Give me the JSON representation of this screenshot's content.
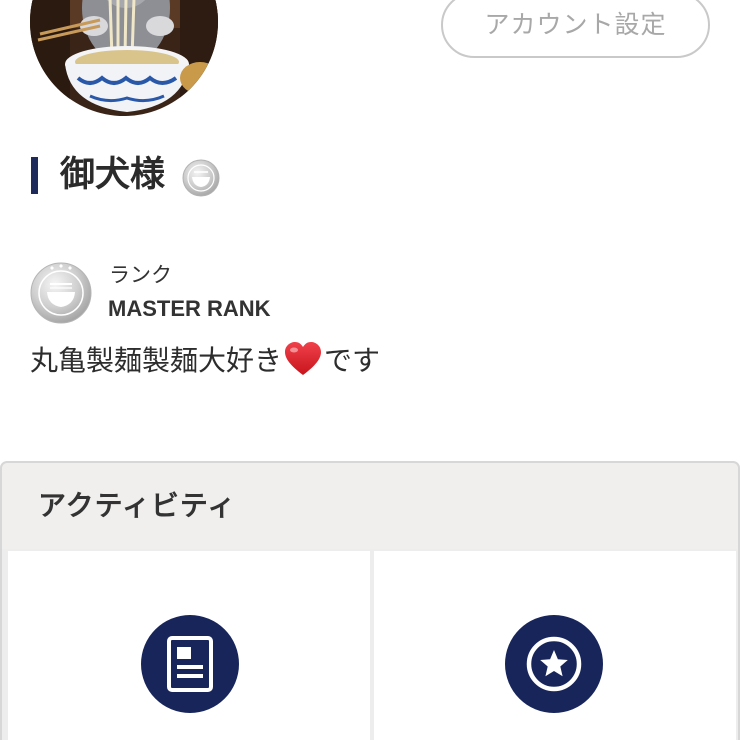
{
  "profile": {
    "avatar_alt": "avatar",
    "name": "御犬様",
    "name_badge_icon": "ramen-bowl-badge-icon",
    "account_settings_label": "アカウント設定"
  },
  "rank": {
    "label": "ランク",
    "value": "MASTER RANK",
    "badge_icon": "master-rank-badge-icon"
  },
  "bio": {
    "text_before": "丸亀製麺製麺大好き",
    "emoji": "heart-icon",
    "text_after": "です"
  },
  "activity": {
    "title": "アクティビティ",
    "items": [
      {
        "icon": "article-icon",
        "count": ""
      },
      {
        "icon": "star-icon",
        "count": ""
      }
    ]
  },
  "colors": {
    "accent_navy": "#1e2a5a",
    "icon_circle": "#17255a",
    "border_gray": "#c9c9c9",
    "header_bg": "#f0efee",
    "heart_red": "#e0252d"
  }
}
